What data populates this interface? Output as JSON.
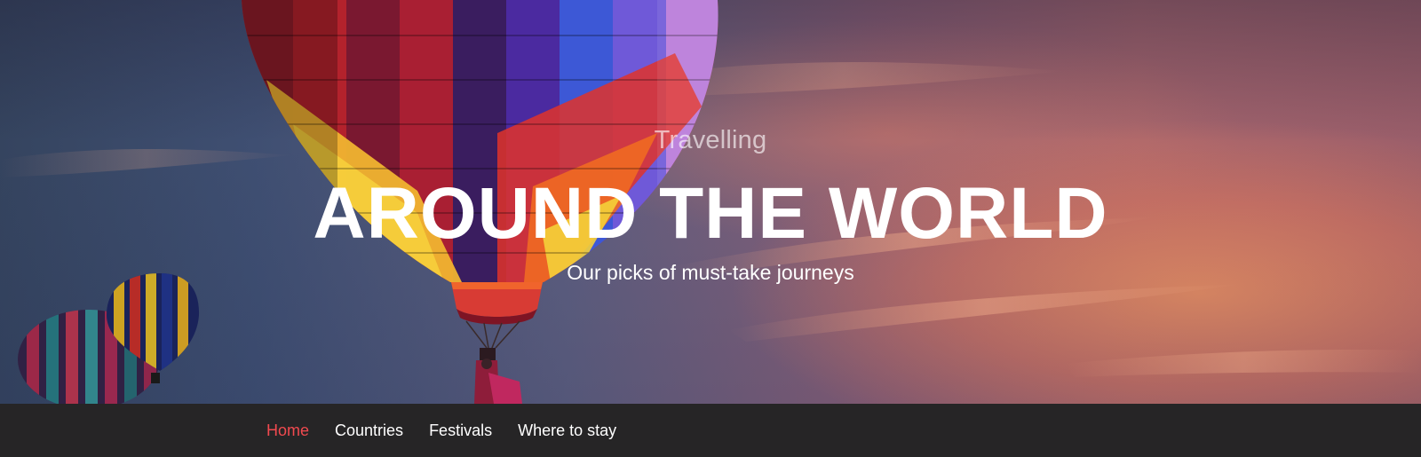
{
  "hero": {
    "eyebrow": "Travelling",
    "title": "AROUND THE WORLD",
    "subtitle": "Our picks of must-take journeys"
  },
  "nav": {
    "items": [
      {
        "label": "Home",
        "active": true
      },
      {
        "label": "Countries",
        "active": false
      },
      {
        "label": "Festivals",
        "active": false
      },
      {
        "label": "Where to stay",
        "active": false
      }
    ]
  },
  "colors": {
    "nav_background": "#262526",
    "nav_active": "#f14a4f",
    "nav_text": "#ffffff"
  }
}
